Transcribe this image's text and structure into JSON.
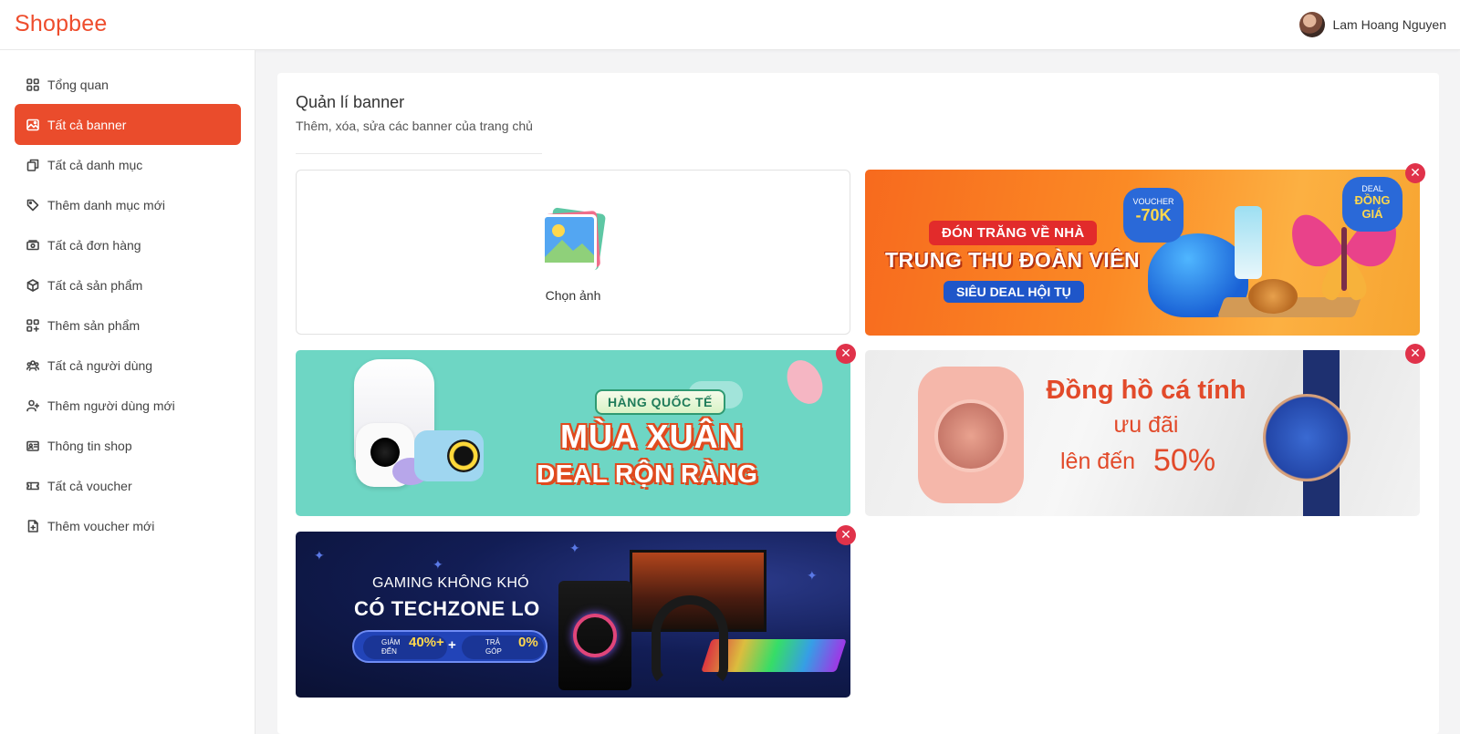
{
  "app": {
    "logo": "Shopbee",
    "user_name": "Lam Hoang Nguyen"
  },
  "sidebar": {
    "items": [
      {
        "label": "Tổng quan",
        "icon": "dashboard-icon"
      },
      {
        "label": "Tất cả banner",
        "icon": "image-icon"
      },
      {
        "label": "Tất cả danh mục",
        "icon": "copy-icon"
      },
      {
        "label": "Thêm danh mục mới",
        "icon": "tag-icon"
      },
      {
        "label": "Tất cả đơn hàng",
        "icon": "money-icon"
      },
      {
        "label": "Tất cả sản phẩm",
        "icon": "box-icon"
      },
      {
        "label": "Thêm sản phẩm",
        "icon": "add-grid-icon"
      },
      {
        "label": "Tất cả người dùng",
        "icon": "users-icon"
      },
      {
        "label": "Thêm người dùng mới",
        "icon": "user-plus-icon"
      },
      {
        "label": "Thông tin shop",
        "icon": "id-card-icon"
      },
      {
        "label": "Tất cả voucher",
        "icon": "ticket-icon"
      },
      {
        "label": "Thêm voucher mới",
        "icon": "file-plus-icon"
      }
    ],
    "active_index": 1
  },
  "main": {
    "title": "Quản lí banner",
    "subtitle": "Thêm, xóa, sửa các banner của trang chủ",
    "upload_label": "Chọn ảnh",
    "remove_symbol": "✕"
  },
  "banners": {
    "trungthu": {
      "pill_top": "ĐÓN TRĂNG VỀ NHÀ",
      "main": "TRUNG THU ĐOÀN VIÊN",
      "pill_bottom": "SIÊU DEAL HỘI TỤ",
      "voucher_caption": "VOUCHER",
      "voucher_value": "-70K",
      "deal_caption": "DEAL",
      "deal_value_1": "ĐỒNG",
      "deal_value_2": "GIÁ"
    },
    "muaxuan": {
      "tag": "HÀNG QUỐC TẾ",
      "line1": "MÙA XUÂN",
      "line2": "DEAL RỘN RÀNG"
    },
    "dongho": {
      "line1": "Đồng hồ cá tính",
      "line2": "ưu đãi",
      "line3": "lên đến",
      "line3_value": "50%"
    },
    "gaming": {
      "line1": "GAMING KHÔNG KHÓ",
      "line2": "CÓ TECHZONE LO",
      "promo_a_caption_1": "GIẢM",
      "promo_a_caption_2": "ĐẾN",
      "promo_a_value": "40%+",
      "plus": "+",
      "promo_b_caption_1": "TRẢ",
      "promo_b_caption_2": "GÓP",
      "promo_b_value": "0%"
    }
  },
  "colors": {
    "brand": "#ee4d2d",
    "active_menu": "#ea4c2c",
    "remove_button": "#e0324a"
  }
}
